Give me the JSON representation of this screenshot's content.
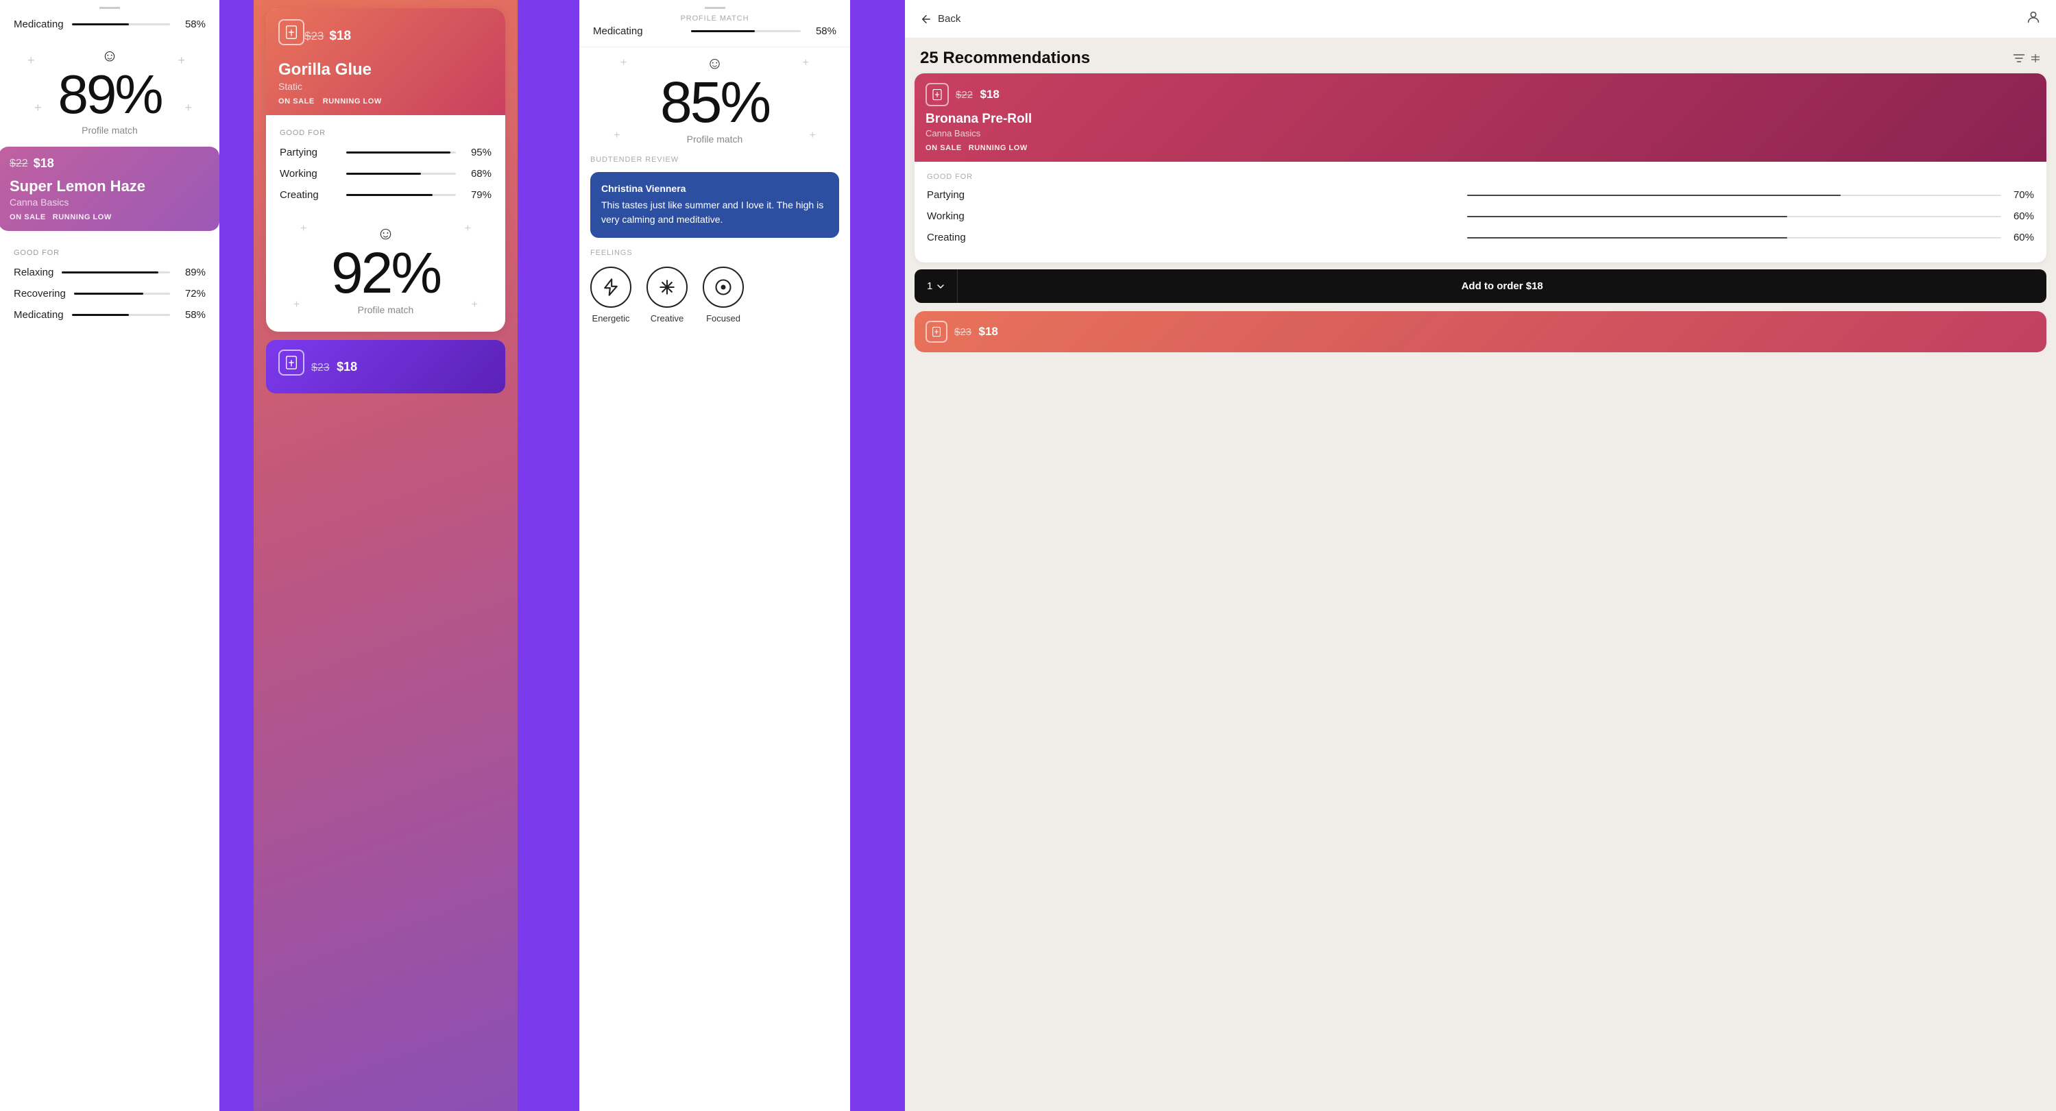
{
  "colors": {
    "purple": "#7c3aed",
    "gradient_start": "#e8735a",
    "gradient_mid": "#c4587a",
    "gradient_end": "#8b4fb5",
    "dark": "#111111",
    "white": "#ffffff",
    "gray_text": "#888888",
    "review_bg": "#2d4fa1",
    "detail_bg": "#f0ede8",
    "card_header_red": "#c94060",
    "add_btn_bg": "#111111"
  },
  "col1": {
    "top_divider": "—",
    "profile_match_top_label": "Profile match",
    "profile_match_top_pct": "89%",
    "card1": {
      "price_old": "$22",
      "price_new": "$18",
      "product_name": "Super Lemon Haze",
      "brand": "Canna Basics",
      "tag1": "ON SALE",
      "tag2": "RUNNING LOW",
      "good_for_label": "GOOD FOR",
      "stats": [
        {
          "label": "Relaxing",
          "pct": 89,
          "pct_text": "89%"
        },
        {
          "label": "Recovering",
          "pct": 72,
          "pct_text": "72%"
        },
        {
          "label": "Medicating",
          "pct": 58,
          "pct_text": "58%"
        }
      ]
    },
    "col1_top_stats": [
      {
        "label": "Medicating",
        "pct": 58,
        "pct_text": "58%"
      }
    ]
  },
  "col3": {
    "card_main": {
      "price_old": "$23",
      "price_new": "$18",
      "product_name": "Gorilla Glue",
      "product_type": "Static",
      "tag1": "ON SALE",
      "tag2": "RUNNING LOW",
      "good_for_label": "GOOD FOR",
      "stats": [
        {
          "label": "Partying",
          "pct": 95,
          "pct_text": "95%"
        },
        {
          "label": "Working",
          "pct": 68,
          "pct_text": "68%"
        },
        {
          "label": "Creating",
          "pct": 79,
          "pct_text": "79%"
        }
      ],
      "profile_match_pct": "92%",
      "profile_match_label": "Profile match"
    },
    "card_bottom": {
      "price_old": "$23",
      "price_new": "$18"
    }
  },
  "col5": {
    "top_divider_label": "Profile match",
    "profile_match_pct": "85%",
    "medicating_pct": "58%",
    "medicating_label": "Medicating",
    "smiley": "☺",
    "budtender_review": {
      "section_label": "BUDTENDER REVIEW",
      "reviewer": "Christina Viennera",
      "text": "This tastes just like summer and I love it. The high is very calming and meditative."
    },
    "feelings": {
      "section_label": "FEELINGS",
      "items": [
        {
          "label": "Energetic",
          "icon": "⚡"
        },
        {
          "label": "Creative",
          "icon": "✳"
        },
        {
          "label": "Focused",
          "icon": "◎"
        }
      ]
    }
  },
  "col7": {
    "back_label": "Back",
    "recommendations_title": "25 Recommendations",
    "filter_icon": "filter",
    "detail_card": {
      "price_old": "$22",
      "price_new": "$18",
      "product_name": "Bronana Pre-Roll",
      "brand": "Canna Basics",
      "tag1": "ON SALE",
      "tag2": "RUNNING LOW",
      "good_for_label": "GOOD FOR",
      "stats": [
        {
          "label": "Partying",
          "pct": 70,
          "pct_text": "70%"
        },
        {
          "label": "Working",
          "pct": 60,
          "pct_text": "60%"
        },
        {
          "label": "Creating",
          "pct": 60,
          "pct_text": "60%"
        }
      ]
    },
    "add_order": {
      "qty": "1",
      "btn_label": "Add to order $18"
    },
    "bottom_card": {
      "price_old": "$23",
      "price_new": "$18"
    }
  }
}
